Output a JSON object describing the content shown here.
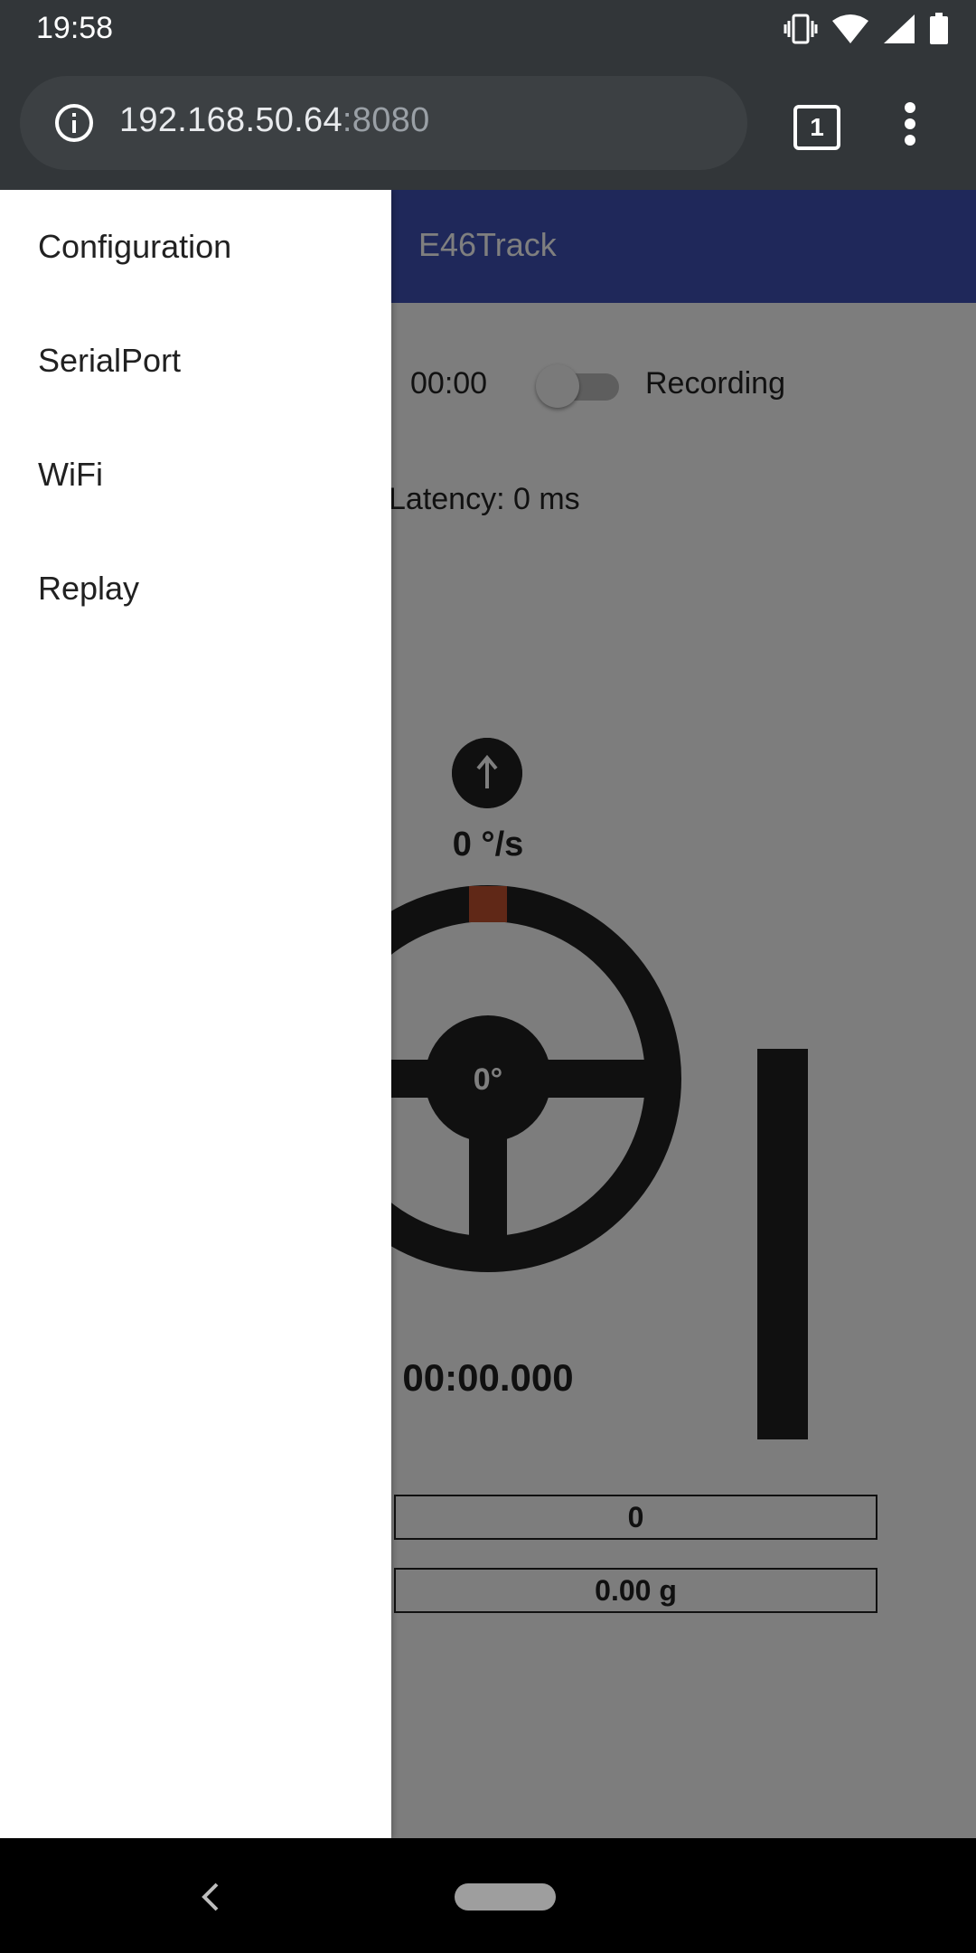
{
  "status_bar": {
    "time": "19:58",
    "icons": [
      "vibrate-icon",
      "wifi-icon",
      "signal-icon",
      "battery-icon"
    ]
  },
  "browser": {
    "url_host": "192.168.50.64",
    "url_port": ":8080",
    "tab_count": "1"
  },
  "app": {
    "title": "E46Track",
    "timer": "00:00",
    "recording_label": "Recording",
    "recording_on": false,
    "latency": "Latency: 0 ms",
    "yaw_rate": "0 °/s",
    "steering_angle": "0°",
    "lap_time": "00:00.000",
    "field_1": "0",
    "field_2": "0.00 g",
    "accent_color": "#3f51b5",
    "marker_color": "#c0502e"
  },
  "drawer": {
    "items": [
      {
        "label": "Configuration"
      },
      {
        "label": "SerialPort"
      },
      {
        "label": "WiFi"
      },
      {
        "label": "Replay"
      }
    ]
  }
}
